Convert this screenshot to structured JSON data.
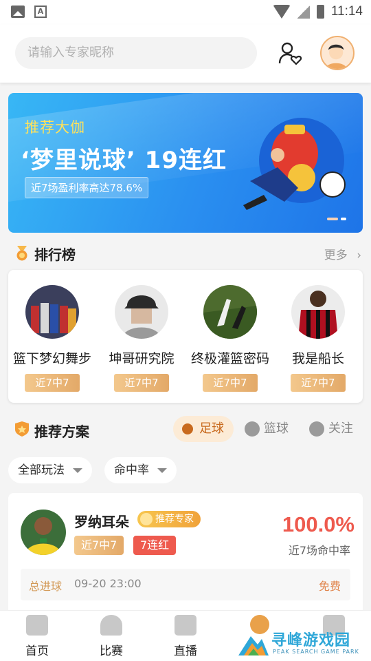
{
  "status_bar": {
    "time": "11:14"
  },
  "search": {
    "placeholder": "请输入专家昵称"
  },
  "banner": {
    "kicker": "推荐大伽",
    "title": "‘梦里说球’ 19连红",
    "chip": "近7场盈利率高达78.6%"
  },
  "ranking": {
    "title": "排行榜",
    "more": "更多",
    "experts": [
      {
        "name": "篮下梦幻舞步",
        "badge": "近7中7"
      },
      {
        "name": "坤哥研究院",
        "badge": "近7中7"
      },
      {
        "name": "终极灌篮密码",
        "badge": "近7中7"
      },
      {
        "name": "我是船长",
        "badge": "近7中7"
      }
    ]
  },
  "recommend": {
    "title": "推荐方案",
    "tabs": [
      "足球",
      "篮球",
      "关注"
    ],
    "filters": [
      "全部玩法",
      "命中率"
    ]
  },
  "plan": {
    "name": "罗纳耳朵",
    "expert_tag": "推荐专家",
    "tag_record": "近7中7",
    "tag_streak": "7连红",
    "rate": "100.0%",
    "rate_label": "近7场命中率",
    "type": "总进球",
    "time": "09-20 23:00",
    "price": "免费"
  },
  "nav": {
    "items": [
      "首页",
      "比赛",
      "直播"
    ]
  },
  "watermark": {
    "text": "寻峰游戏园",
    "sub": "PEAK SEARCH GAME PARK"
  },
  "colors": {
    "accent_red": "#ee5a4e",
    "gold": "#e3a968",
    "banner_blue": "#2a8ff0"
  }
}
